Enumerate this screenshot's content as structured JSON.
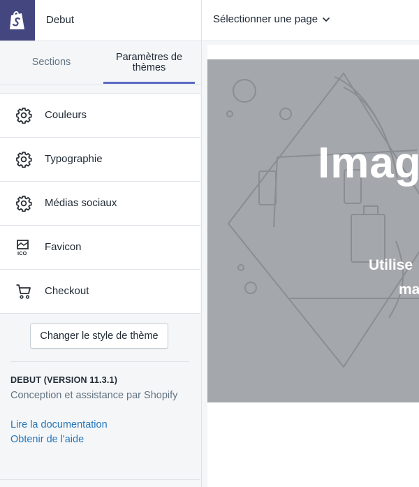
{
  "app": {
    "theme_name": "Debut",
    "logo_icon": "shopify-bag-icon",
    "accent_color": "#5c6ac4",
    "logo_bg_color": "#43467f"
  },
  "tabs": [
    {
      "label": "Sections",
      "active": false
    },
    {
      "label": "Paramètres de thèmes",
      "active": true
    }
  ],
  "menu": [
    {
      "label": "Couleurs",
      "icon": "gear-icon"
    },
    {
      "label": "Typographie",
      "icon": "gear-icon"
    },
    {
      "label": "Médias sociaux",
      "icon": "gear-icon"
    },
    {
      "label": "Favicon",
      "icon": "favicon-icon"
    },
    {
      "label": "Checkout",
      "icon": "cart-icon"
    }
  ],
  "change_style_button": "Changer le style de thème",
  "theme_info": {
    "version": "DEBUT (VERSION 11.3.1)",
    "credit": "Conception et assistance par Shopify",
    "links": [
      "Lire la documentation",
      "Obtenir de l'aide"
    ],
    "link_color": "#2776b9"
  },
  "preview": {
    "page_selector": "Sélectionner une page",
    "hero_title": "Imag",
    "hero_subtitle_1": "Utilise",
    "hero_subtitle_2": "ma",
    "hero_bg_color": "#a4a7ab"
  }
}
